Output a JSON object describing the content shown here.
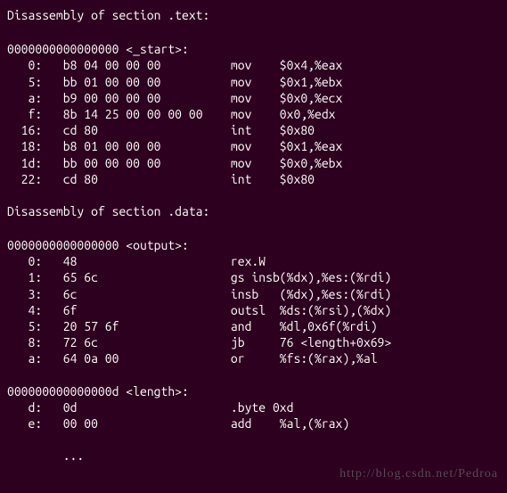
{
  "sections": [
    {
      "header": "Disassembly of section .text:",
      "symbols": [
        {
          "address": "0000000000000000",
          "name": "<_start>:",
          "lines": [
            {
              "offset": "   0:",
              "hex": "b8 04 00 00 00       ",
              "mnemonic": "mov",
              "operands": "$0x4,%eax"
            },
            {
              "offset": "   5:",
              "hex": "bb 01 00 00 00       ",
              "mnemonic": "mov",
              "operands": "$0x1,%ebx"
            },
            {
              "offset": "   a:",
              "hex": "b9 00 00 00 00       ",
              "mnemonic": "mov",
              "operands": "$0x0,%ecx"
            },
            {
              "offset": "   f:",
              "hex": "8b 14 25 00 00 00 00 ",
              "mnemonic": "mov",
              "operands": "0x0,%edx"
            },
            {
              "offset": "  16:",
              "hex": "cd 80                ",
              "mnemonic": "int",
              "operands": "$0x80"
            },
            {
              "offset": "  18:",
              "hex": "b8 01 00 00 00       ",
              "mnemonic": "mov",
              "operands": "$0x1,%eax"
            },
            {
              "offset": "  1d:",
              "hex": "bb 00 00 00 00       ",
              "mnemonic": "mov",
              "operands": "$0x0,%ebx"
            },
            {
              "offset": "  22:",
              "hex": "cd 80                ",
              "mnemonic": "int",
              "operands": "$0x80"
            }
          ]
        }
      ]
    },
    {
      "header": "Disassembly of section .data:",
      "symbols": [
        {
          "address": "0000000000000000",
          "name": "<output>:",
          "lines": [
            {
              "offset": "   0:",
              "hex": "48                   ",
              "mnemonic": "rex.W",
              "operands": ""
            },
            {
              "offset": "   1:",
              "hex": "65 6c                ",
              "mnemonic": "gs insb",
              "operands": "(%dx),%es:(%rdi)"
            },
            {
              "offset": "   3:",
              "hex": "6c                   ",
              "mnemonic": "insb",
              "operands": "(%dx),%es:(%rdi)"
            },
            {
              "offset": "   4:",
              "hex": "6f                   ",
              "mnemonic": "outsl",
              "operands": "%ds:(%rsi),(%dx)"
            },
            {
              "offset": "   5:",
              "hex": "20 57 6f             ",
              "mnemonic": "and",
              "operands": "%dl,0x6f(%rdi)"
            },
            {
              "offset": "   8:",
              "hex": "72 6c                ",
              "mnemonic": "jb",
              "operands": "76 <length+0x69>"
            },
            {
              "offset": "   a:",
              "hex": "64 0a 00             ",
              "mnemonic": "or",
              "operands": "%fs:(%rax),%al"
            }
          ]
        },
        {
          "address": "000000000000000d",
          "name": "<length>:",
          "lines": [
            {
              "offset": "   d:",
              "hex": "0d                   ",
              "mnemonic": ".byte 0xd",
              "operands": ""
            },
            {
              "offset": "   e:",
              "hex": "00 00                ",
              "mnemonic": "add",
              "operands": "%al,(%rax)"
            }
          ]
        }
      ]
    }
  ],
  "ellipsis": "        ...",
  "watermark": "http://blog.csdn.net/Pedroa"
}
